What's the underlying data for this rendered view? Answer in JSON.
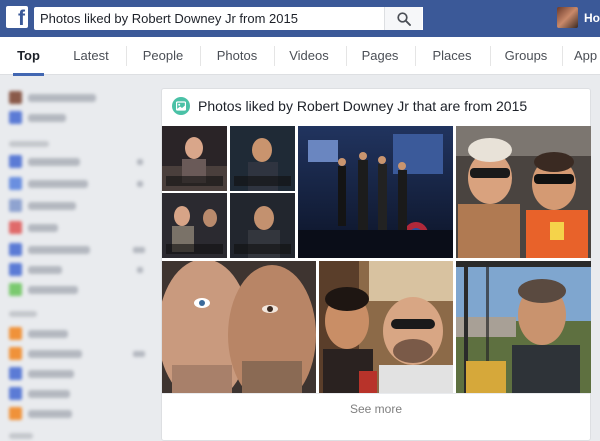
{
  "header": {
    "search_value": "Photos liked by Robert Downey Jr from 2015",
    "user_name": "Hom"
  },
  "tabs": [
    {
      "label": "Top",
      "active": true
    },
    {
      "label": "Latest"
    },
    {
      "label": "People"
    },
    {
      "label": "Photos"
    },
    {
      "label": "Videos"
    },
    {
      "label": "Pages"
    },
    {
      "label": "Places"
    },
    {
      "label": "Groups"
    },
    {
      "label": "App"
    }
  ],
  "card": {
    "title": "Photos liked by Robert Downey Jr that are from 2015",
    "see_more": "See more"
  },
  "photos": [
    {
      "name": "photo-interview-collage",
      "colors": [
        "#2c2628",
        "#8a6b5a"
      ]
    },
    {
      "name": "photo-avengers-premiere",
      "colors": [
        "#1e2f5c",
        "#b03040"
      ]
    },
    {
      "name": "photo-car-selfie-sunglasses",
      "colors": [
        "#3a3632",
        "#d8a070"
      ]
    },
    {
      "name": "photo-close-up-faces",
      "colors": [
        "#4a3a30",
        "#c79a7e"
      ]
    },
    {
      "name": "photo-street-selfie",
      "colors": [
        "#7a5a3a",
        "#c9a27a"
      ]
    },
    {
      "name": "photo-balcony-portrait",
      "colors": [
        "#6b8fb4",
        "#4a5a38"
      ]
    }
  ],
  "icons": {
    "logo": "facebook-f-logo",
    "search": "search-icon",
    "card": "photo-icon"
  },
  "colors": {
    "brand": "#3b5998",
    "tab_active": "#4267b2",
    "card_icon": "#4ac1a6"
  }
}
